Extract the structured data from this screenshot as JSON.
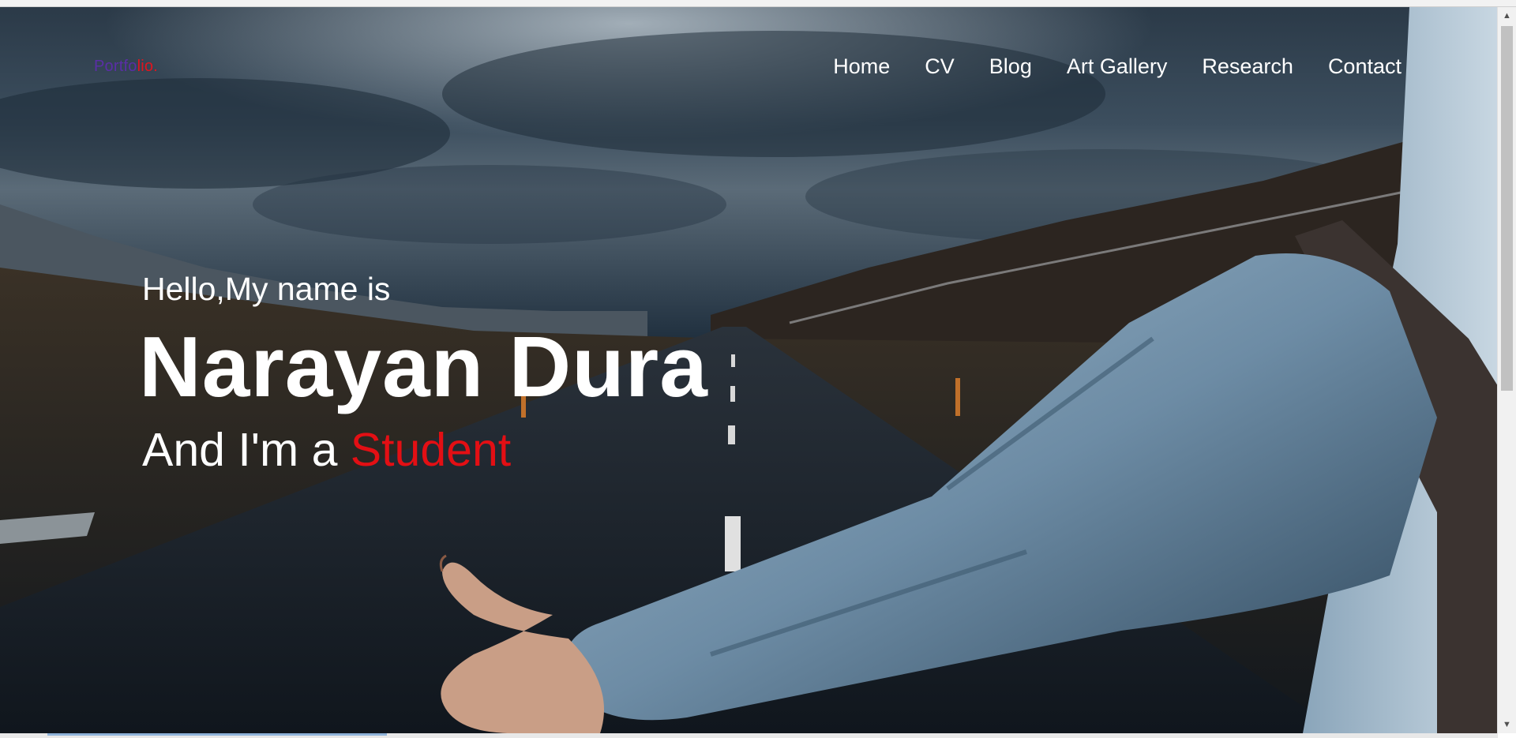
{
  "logo": {
    "part1": "Portfo",
    "part2": "lio."
  },
  "nav": {
    "items": [
      {
        "label": "Home"
      },
      {
        "label": "CV"
      },
      {
        "label": "Blog"
      },
      {
        "label": "Art Gallery"
      },
      {
        "label": "Research"
      },
      {
        "label": "Contact"
      }
    ]
  },
  "hero": {
    "greeting": "Hello,My name is",
    "name": "Narayan Dura",
    "role_prefix": "And I'm a ",
    "role_highlight": "Student"
  },
  "colors": {
    "logo_primary": "#5a2ea6",
    "accent_red": "#e30f14",
    "text": "#ffffff"
  },
  "icons": {
    "scroll_up": "▲",
    "scroll_down": "▼"
  }
}
